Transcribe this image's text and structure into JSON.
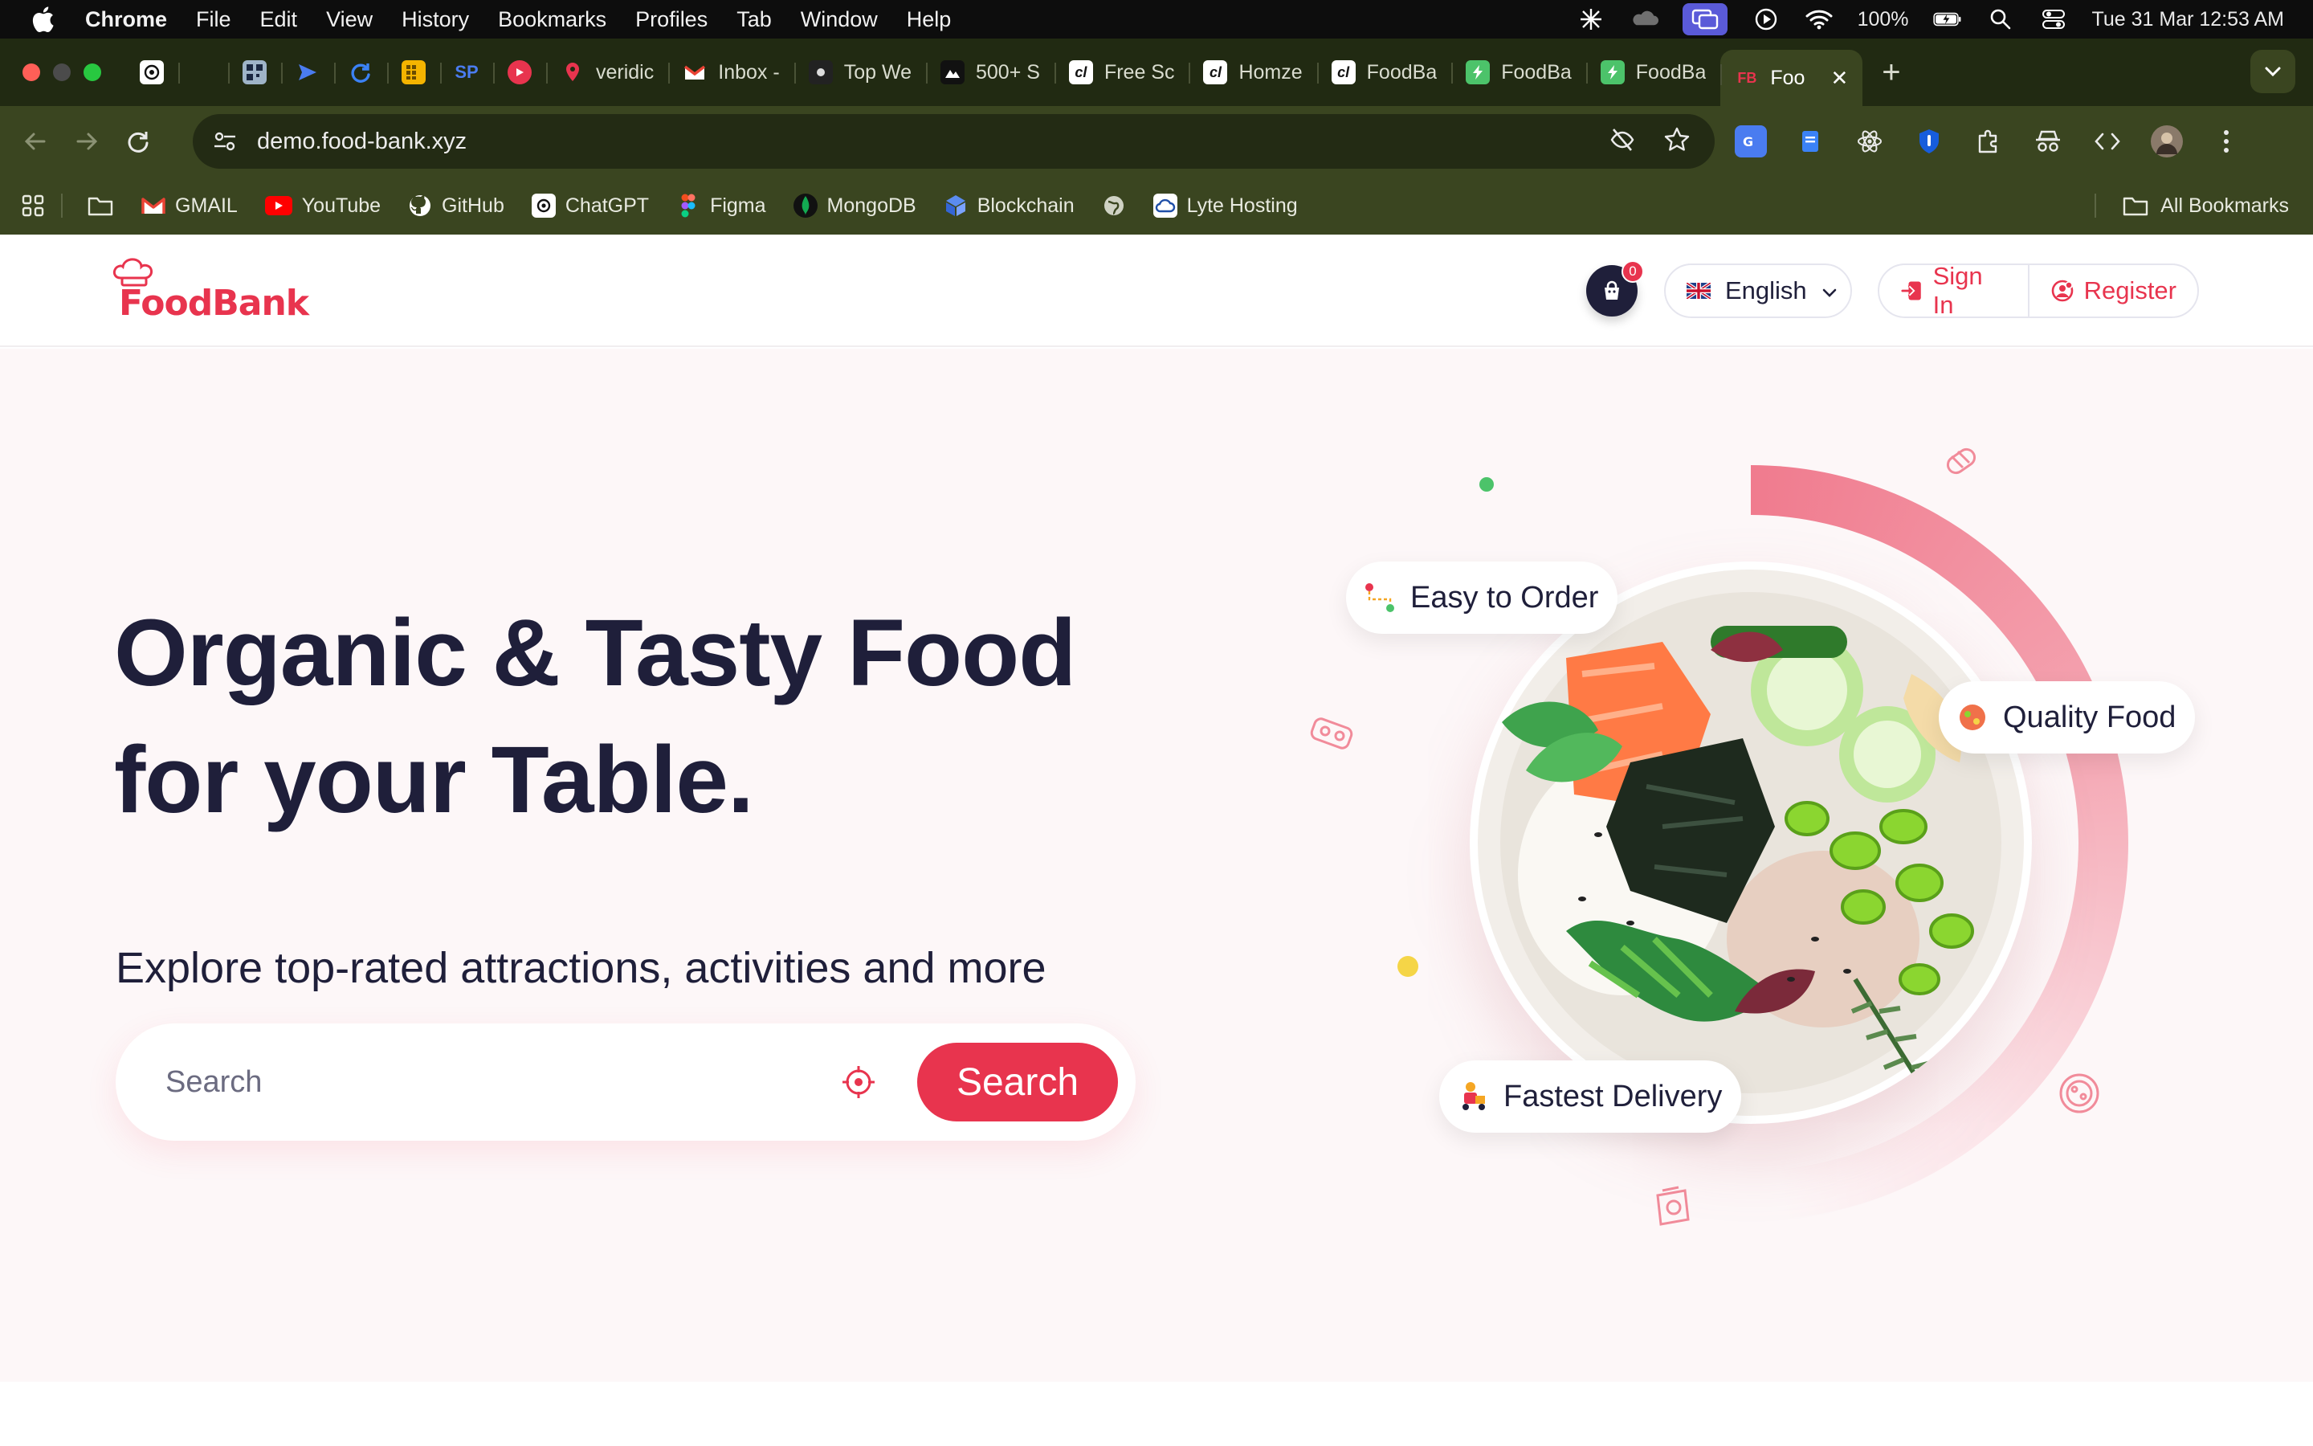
{
  "menubar": {
    "app_name": "Chrome",
    "items": [
      "File",
      "Edit",
      "View",
      "History",
      "Bookmarks",
      "Profiles",
      "Tab",
      "Window",
      "Help"
    ],
    "battery": "100%",
    "datetime": "Tue 31 Mar  12:53 AM"
  },
  "tabs": [
    {
      "label": "veridic",
      "icon": "map-pin-icon",
      "color": "#e8344e"
    },
    {
      "label": "Inbox -",
      "icon": "gmail-icon",
      "color": "#ea4335"
    },
    {
      "label": "Top We",
      "icon": "site-icon",
      "color": "#222222"
    },
    {
      "label": "500+ S",
      "icon": "site-icon",
      "color": "#111111"
    },
    {
      "label": "Free Sc",
      "icon": "cl-icon",
      "color": "#111111"
    },
    {
      "label": "Homze",
      "icon": "cl-icon",
      "color": "#111111"
    },
    {
      "label": "FoodBa",
      "icon": "cl-icon",
      "color": "#111111"
    },
    {
      "label": "FoodBa",
      "icon": "flash-icon",
      "color": "#4cc36a"
    },
    {
      "label": "FoodBa",
      "icon": "flash-icon",
      "color": "#4cc36a"
    },
    {
      "label": "Foo",
      "icon": "foodbank-icon",
      "color": "#e8344e",
      "active": true
    }
  ],
  "toolbar": {
    "url": "demo.food-bank.xyz"
  },
  "bookmarks": {
    "items": [
      {
        "label": "GMAIL",
        "icon": "gmail-icon"
      },
      {
        "label": "YouTube",
        "icon": "youtube-icon"
      },
      {
        "label": "GitHub",
        "icon": "github-icon"
      },
      {
        "label": "ChatGPT",
        "icon": "chatgpt-icon"
      },
      {
        "label": "Figma",
        "icon": "figma-icon"
      },
      {
        "label": "MongoDB",
        "icon": "mongodb-icon"
      },
      {
        "label": "Blockchain",
        "icon": "blockchain-icon"
      },
      {
        "label": "Lyte Hosting",
        "icon": "cloud-icon"
      }
    ],
    "all_label": "All Bookmarks"
  },
  "header": {
    "logo_text": "FoodBank",
    "cart_count": "0",
    "language": "English",
    "sign_in": "Sign In",
    "register": "Register"
  },
  "hero": {
    "title_line1": "Organic & Tasty Food",
    "title_line2": "for your Table.",
    "subtitle": "Explore top-rated attractions, activities and more",
    "search_placeholder": "Search",
    "search_button": "Search",
    "badges": {
      "easy": "Easy to Order",
      "quality": "Quality Food",
      "delivery": "Fastest Delivery"
    }
  },
  "colors": {
    "brand": "#e8344e",
    "dark": "#1f1f3a",
    "hero_bg": "#fdf7f8"
  }
}
